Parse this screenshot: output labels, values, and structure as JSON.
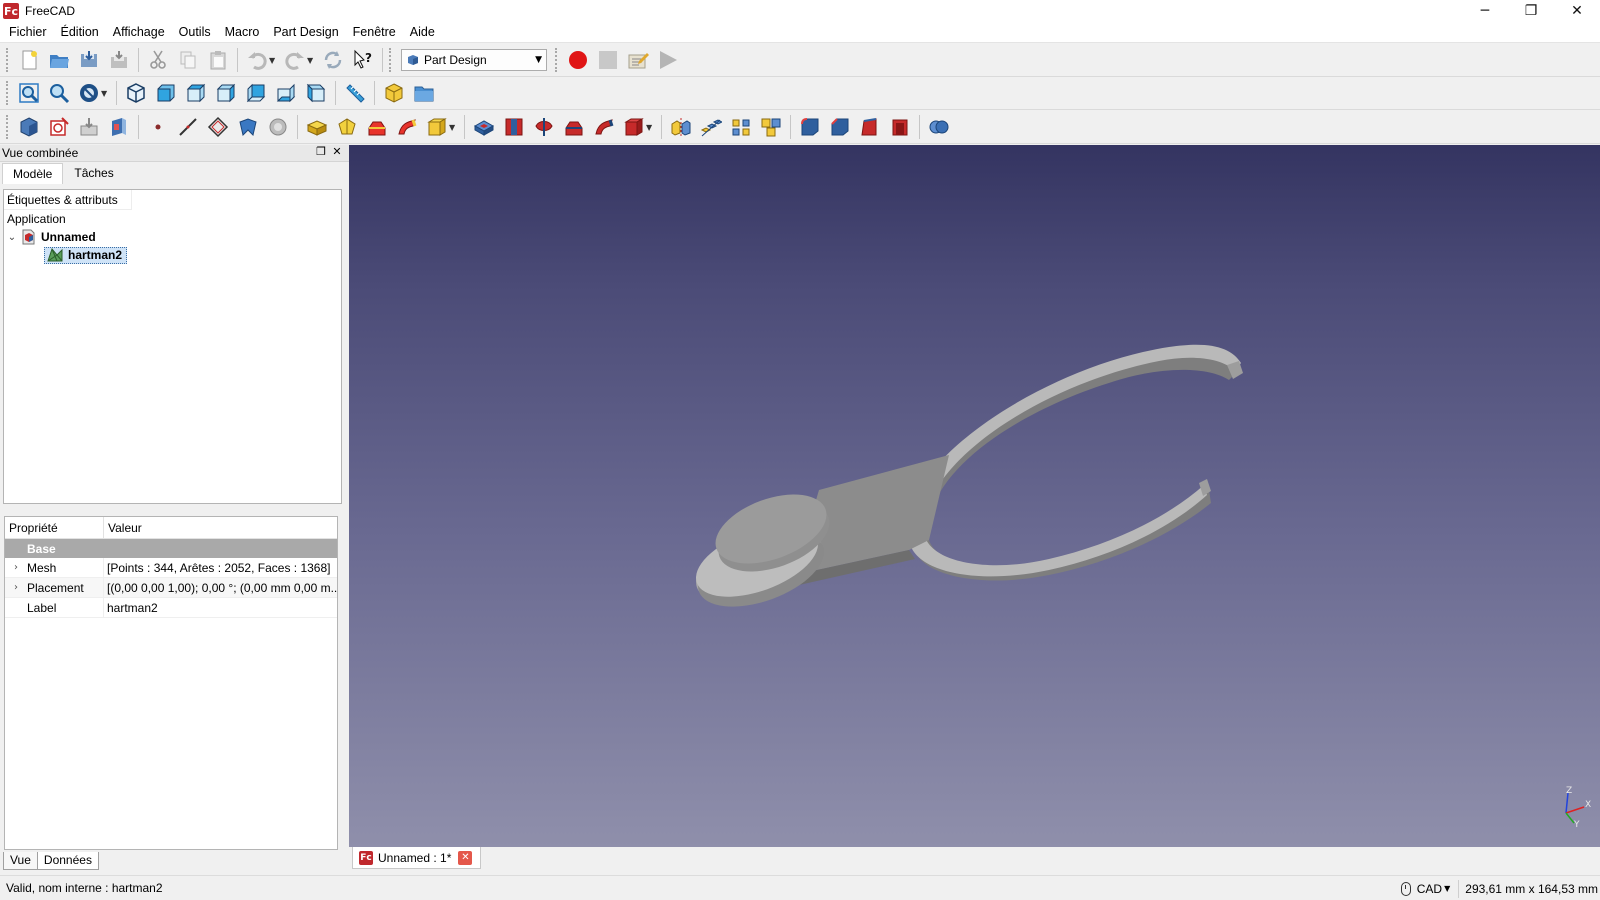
{
  "window": {
    "title": "FreeCAD",
    "minimize": "─",
    "restore": "❐",
    "close": "✕",
    "logo_text": "Fc"
  },
  "menu": [
    "Fichier",
    "Édition",
    "Affichage",
    "Outils",
    "Macro",
    "Part Design",
    "Fenêtre",
    "Aide"
  ],
  "workbench": {
    "selected": "Part Design"
  },
  "combo": {
    "title": "Vue combinée",
    "tabs": [
      "Modèle",
      "Tâches"
    ],
    "tree_header": "Étiquettes & attributs",
    "application_label": "Application",
    "document": "Unnamed",
    "object": "hartman2"
  },
  "properties": {
    "col_name": "Propriété",
    "col_value": "Valeur",
    "group": "Base",
    "rows": [
      {
        "name": "Mesh",
        "value": "[Points : 344, Arêtes : 2052, Faces : 1368]",
        "expandable": true
      },
      {
        "name": "Placement",
        "value": "[(0,00 0,00 1,00); 0,00 °; (0,00 mm  0,00 m...",
        "expandable": true
      },
      {
        "name": "Label",
        "value": "hartman2",
        "expandable": false
      }
    ]
  },
  "bottom_tabs": [
    "Vue",
    "Données"
  ],
  "doc_tab": {
    "label": "Unnamed : 1*",
    "close": "✕",
    "logo_text": "Fc"
  },
  "axes": {
    "z": "Z",
    "x": "X",
    "y": "Y"
  },
  "status": {
    "message": "Valid, nom interne : hartman2",
    "navigation": "CAD",
    "dimensions": "293,61 mm x 164,53 mm"
  },
  "colors": {
    "view_top": "#343461",
    "view_bottom": "#8f8fab",
    "record_red": "#e01515",
    "model_gray": "#9b9b9b"
  }
}
